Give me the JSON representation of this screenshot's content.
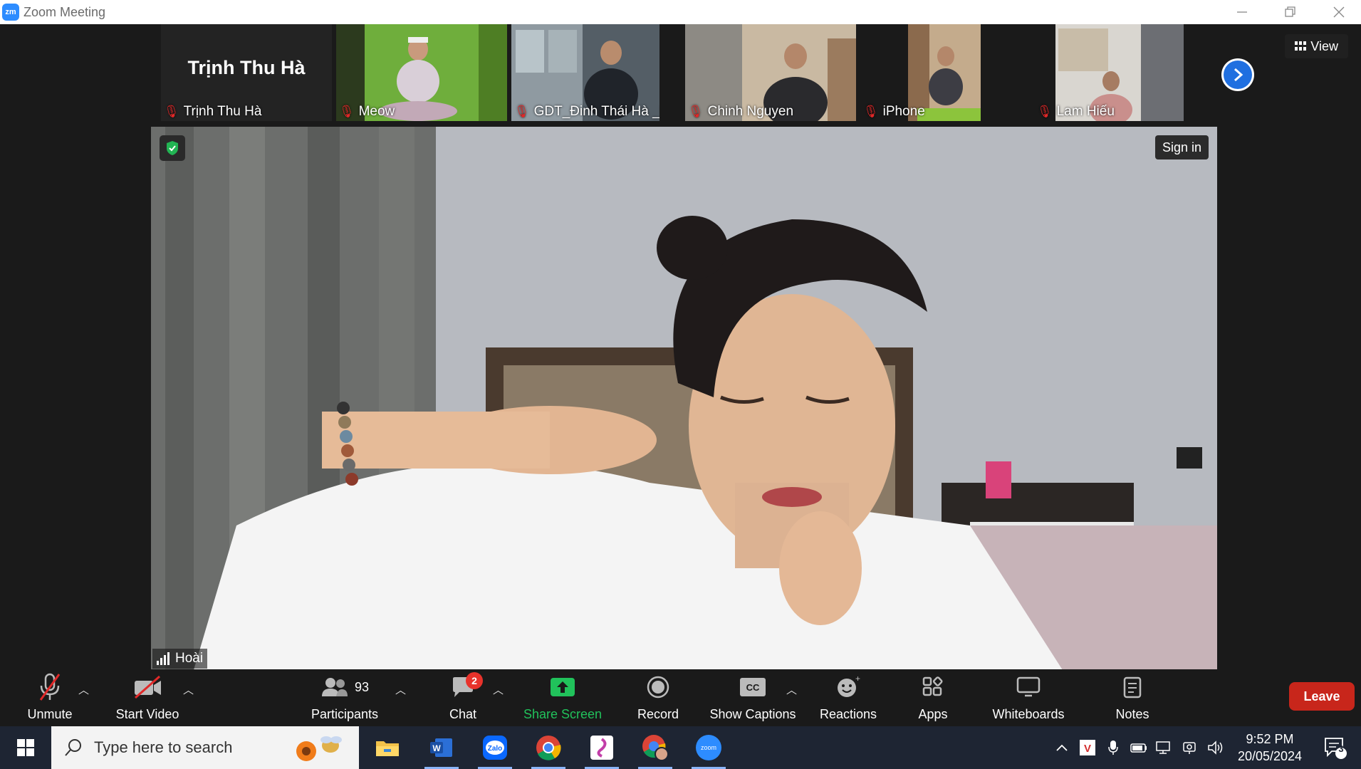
{
  "window": {
    "title": "Zoom Meeting",
    "logo_text": "zm"
  },
  "gallery": {
    "view_label": "View",
    "tiles": [
      {
        "name": "Trịnh Thu Hà",
        "big_name": "Trịnh Thu Hà",
        "video": false
      },
      {
        "name": "Meow",
        "video": true
      },
      {
        "name": "GDT_Đinh Thái Hà _M...",
        "video": true
      },
      {
        "name": "Chinh Nguyen",
        "video": true
      },
      {
        "name": "iPhone",
        "video": true
      },
      {
        "name": "Lam Hiếu",
        "video": true
      }
    ]
  },
  "main_video": {
    "speaker": "Hoài",
    "sign_in_label": "Sign in"
  },
  "toolbar": {
    "unmute": "Unmute",
    "start_video": "Start Video",
    "participants": "Participants",
    "participants_count": "93",
    "chat": "Chat",
    "chat_badge": "2",
    "share_screen": "Share Screen",
    "record": "Record",
    "show_captions": "Show Captions",
    "reactions": "Reactions",
    "apps": "Apps",
    "whiteboards": "Whiteboards",
    "notes": "Notes",
    "leave": "Leave"
  },
  "taskbar": {
    "search_placeholder": "Type here to search",
    "apps": [
      "File Explorer",
      "Word",
      "Zalo",
      "Chrome",
      "App",
      "Chrome Profile",
      "Zoom"
    ],
    "time": "9:52 PM",
    "date": "20/05/2024",
    "notification_count": "3"
  },
  "colors": {
    "accent_blue": "#2d8cff",
    "share_green": "#21c25b",
    "leave_red": "#c8261b",
    "muted_red": "#e02828"
  }
}
